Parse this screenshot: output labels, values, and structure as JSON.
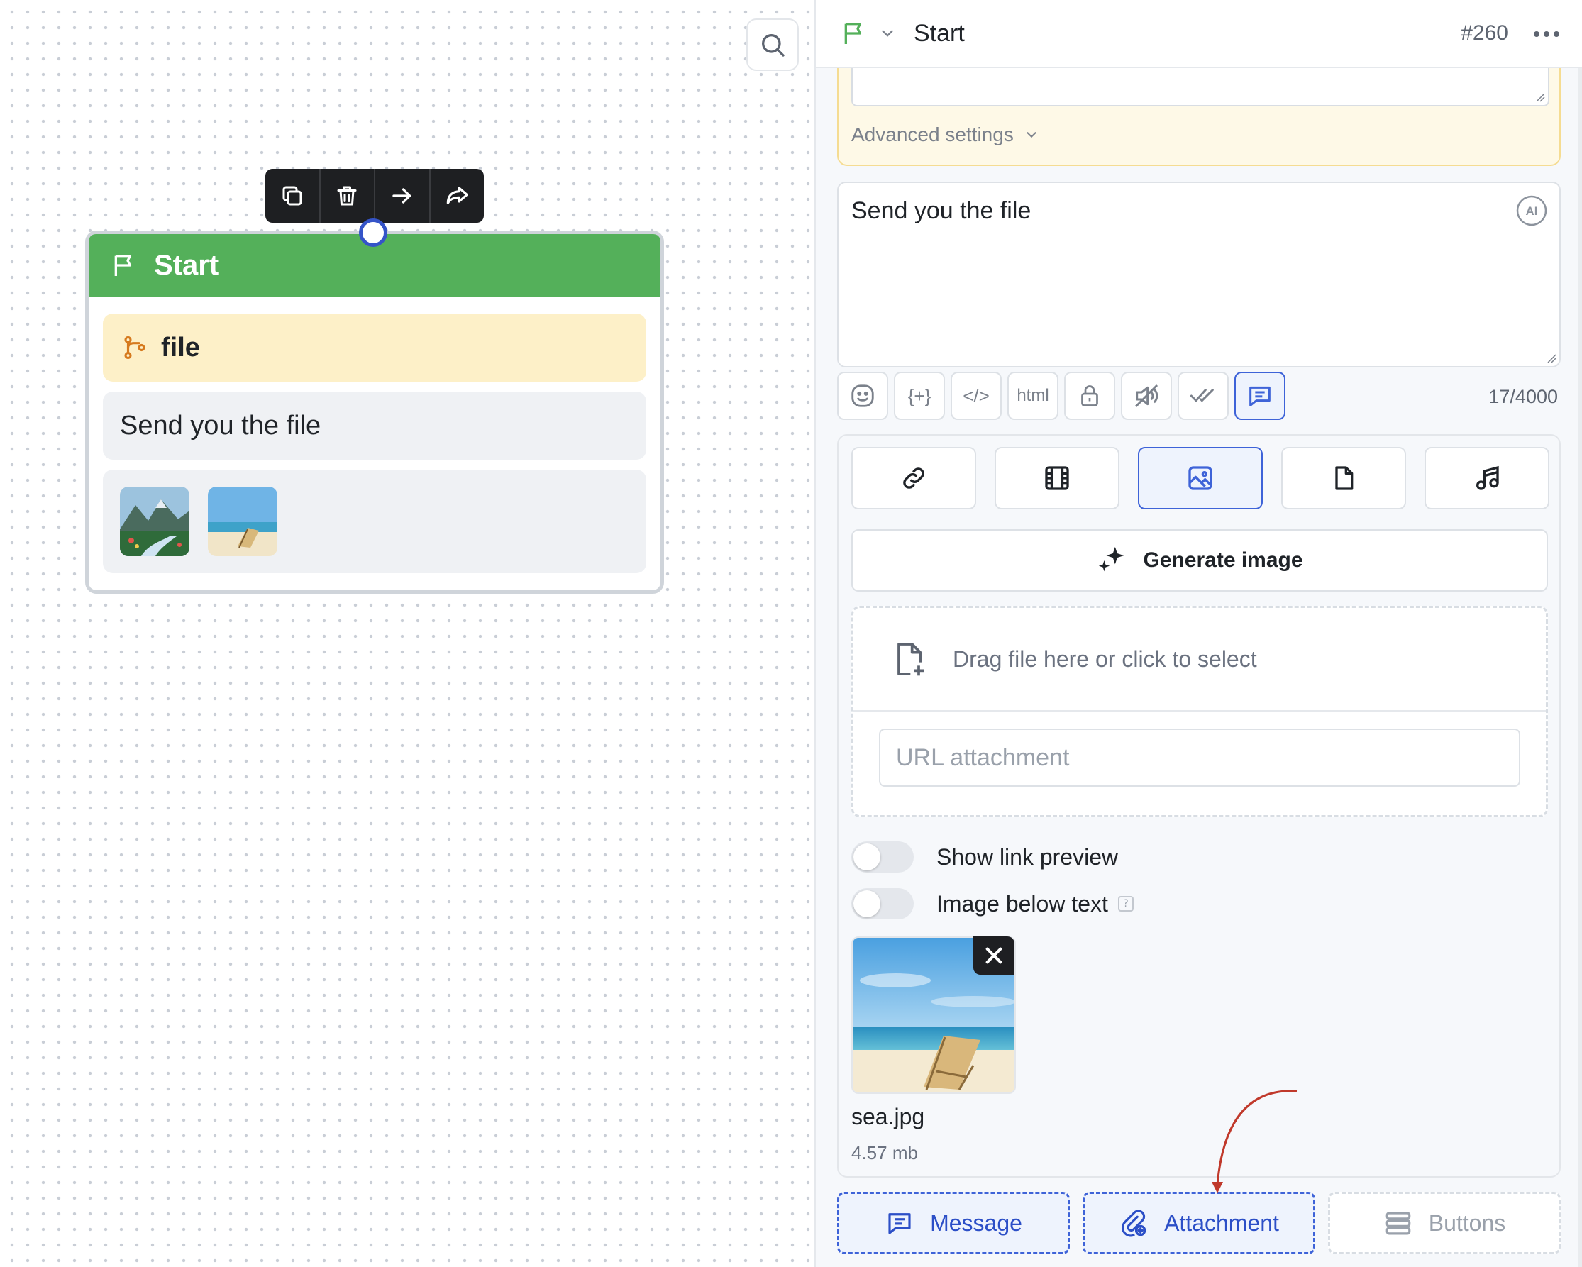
{
  "canvas": {
    "node": {
      "title": "Start",
      "variable": "file",
      "message": "Send you the file",
      "images": [
        "mountain-river",
        "beach-chair"
      ]
    },
    "toolbar": [
      "copy-icon",
      "trash-icon",
      "arrow-right-icon",
      "share-icon"
    ]
  },
  "panel": {
    "header": {
      "title": "Start",
      "id": "#260"
    },
    "advanced_settings": "Advanced settings",
    "message_text": "Send you the file",
    "ai_badge": "AI",
    "format_buttons": [
      "emoji",
      "{+}",
      "</>",
      "html",
      "lock",
      "mute",
      "double-check",
      "chat"
    ],
    "char_count": "17/4000",
    "attachment_types": [
      "link",
      "video",
      "image",
      "file",
      "audio"
    ],
    "generate_label": "Generate image",
    "drop_text": "Drag file here or click to select",
    "url_placeholder": "URL attachment",
    "toggles": {
      "link_preview": "Show link preview",
      "image_below": "Image below text"
    },
    "file": {
      "name": "sea.jpg",
      "size": "4.57 mb"
    },
    "add_buttons": {
      "message": "Message",
      "attachment": "Attachment",
      "buttons": "Buttons"
    }
  },
  "colors": {
    "node_header": "#54b05a",
    "accent": "#3e63d8",
    "variable_bg": "#fdf0c8",
    "annotation_arrow": "#c0392b"
  }
}
